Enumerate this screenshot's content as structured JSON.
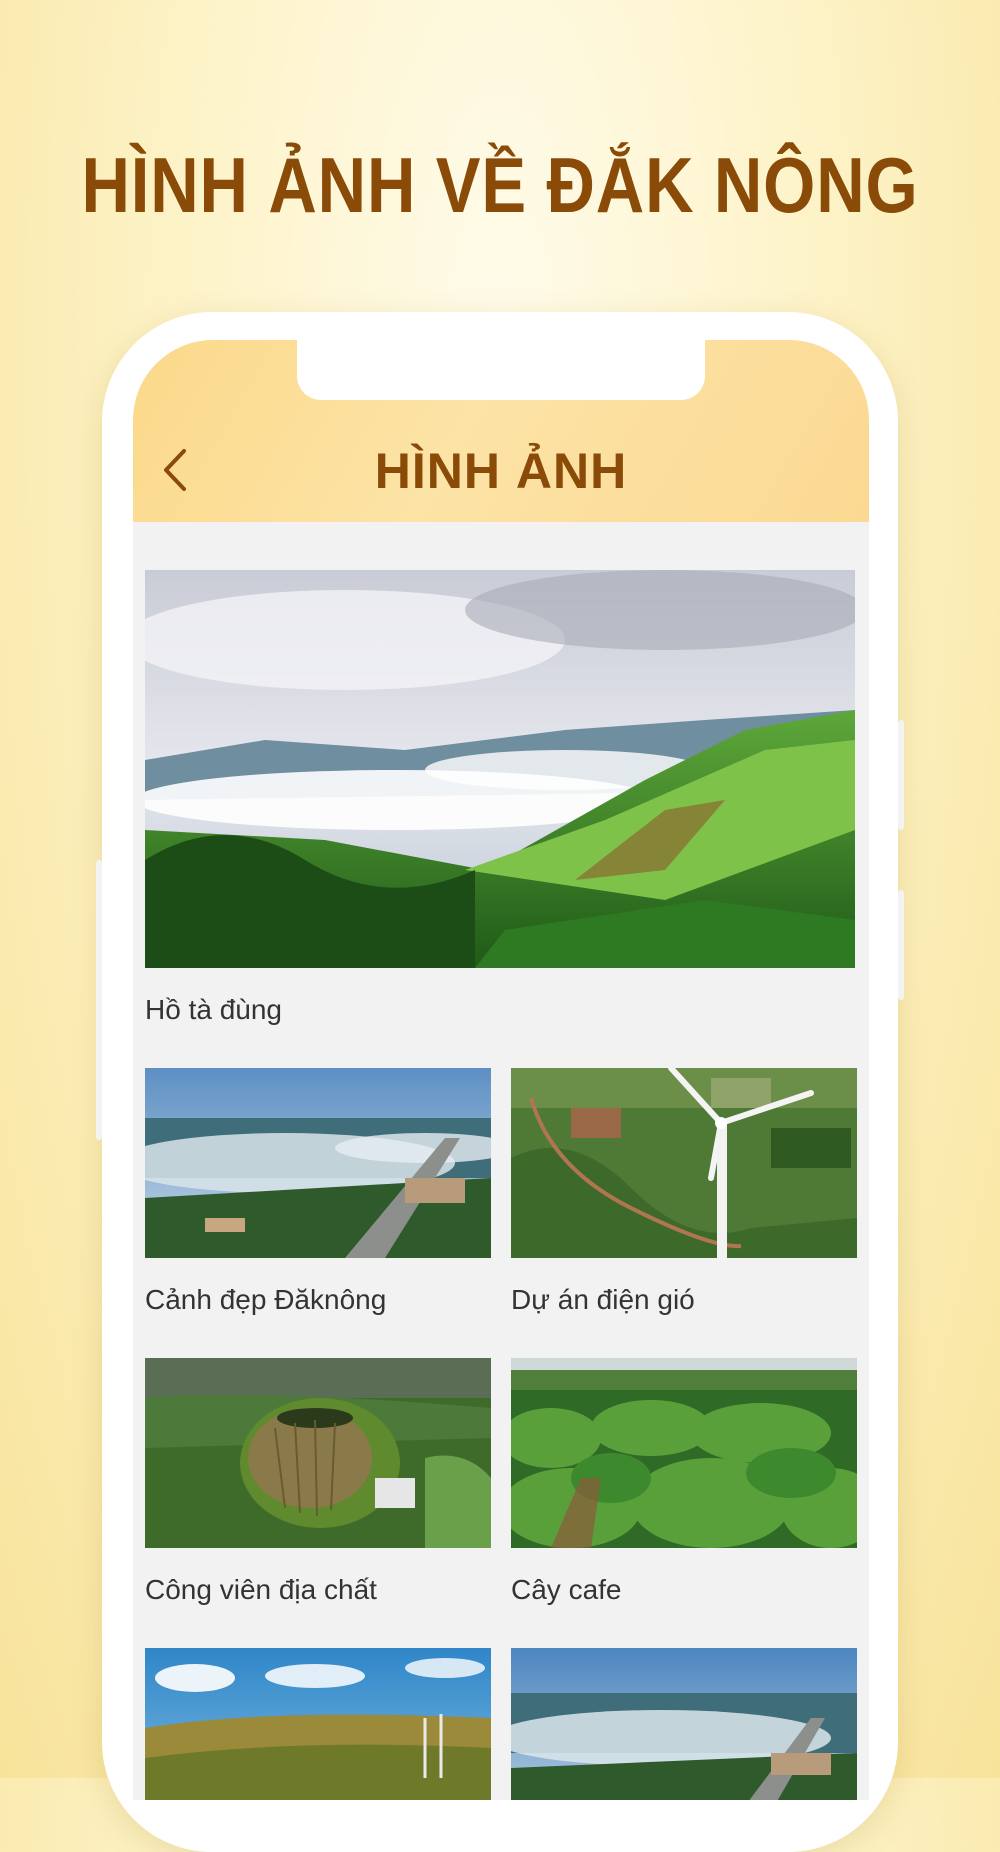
{
  "promo": {
    "title": "HÌNH ẢNH VỀ ĐẮK NÔNG"
  },
  "header": {
    "title": "HÌNH ẢNH",
    "back_icon": "chevron-left-icon"
  },
  "colors": {
    "brand_brown": "#8a4a08",
    "header_bg": "#fbd98a",
    "screen_bg": "#f2f2f2"
  },
  "gallery": {
    "items": [
      {
        "caption": "Hồ tà đùng"
      },
      {
        "caption": "Cảnh đẹp Đăknông"
      },
      {
        "caption": "Dự án điện gió"
      },
      {
        "caption": "Công viên địa chất"
      },
      {
        "caption": "Cây cafe"
      },
      {
        "caption": ""
      },
      {
        "caption": ""
      }
    ]
  }
}
